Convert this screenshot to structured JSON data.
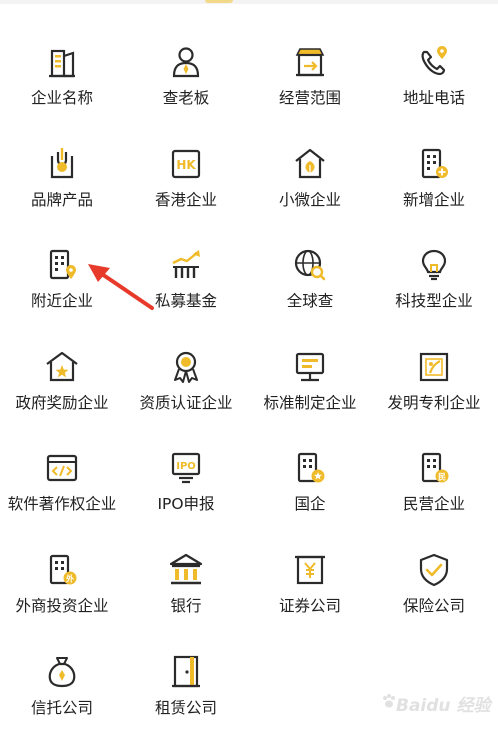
{
  "colors": {
    "icon_stroke": "#2b2b2b",
    "icon_accent": "#f0bb2a",
    "label": "#222222",
    "arrow": "#e83a2b"
  },
  "services": [
    {
      "label": "企业名称",
      "icon": "building-icon"
    },
    {
      "label": "查老板",
      "icon": "boss-person-icon"
    },
    {
      "label": "经营范围",
      "icon": "storefront-icon"
    },
    {
      "label": "地址电话",
      "icon": "phone-location-icon"
    },
    {
      "label": "品牌产品",
      "icon": "brand-product-icon"
    },
    {
      "label": "香港企业",
      "icon": "hk-badge-icon"
    },
    {
      "label": "小微企业",
      "icon": "small-house-leaf-icon"
    },
    {
      "label": "新增企业",
      "icon": "new-building-icon"
    },
    {
      "label": "附近企业",
      "icon": "nearby-building-icon"
    },
    {
      "label": "私募基金",
      "icon": "rising-chart-icon"
    },
    {
      "label": "全球查",
      "icon": "globe-search-icon"
    },
    {
      "label": "科技型企业",
      "icon": "lightbulb-icon"
    },
    {
      "label": "政府奖励企业",
      "icon": "star-house-icon"
    },
    {
      "label": "资质认证企业",
      "icon": "award-ribbon-icon"
    },
    {
      "label": "标准制定企业",
      "icon": "monitor-standard-icon"
    },
    {
      "label": "发明专利企业",
      "icon": "patent-certificate-icon"
    },
    {
      "label": "软件著作权企业",
      "icon": "code-window-icon"
    },
    {
      "label": "IPO申报",
      "icon": "ipo-screen-icon"
    },
    {
      "label": "国企",
      "icon": "state-building-icon"
    },
    {
      "label": "民营企业",
      "icon": "private-building-icon"
    },
    {
      "label": "外商投资企业",
      "icon": "foreign-building-icon"
    },
    {
      "label": "银行",
      "icon": "bank-icon"
    },
    {
      "label": "证券公司",
      "icon": "securities-yen-icon"
    },
    {
      "label": "保险公司",
      "icon": "shield-check-icon"
    },
    {
      "label": "信托公司",
      "icon": "money-bag-icon"
    },
    {
      "label": "租赁公司",
      "icon": "door-icon"
    }
  ],
  "watermark": {
    "text": "Baidu 经验"
  }
}
